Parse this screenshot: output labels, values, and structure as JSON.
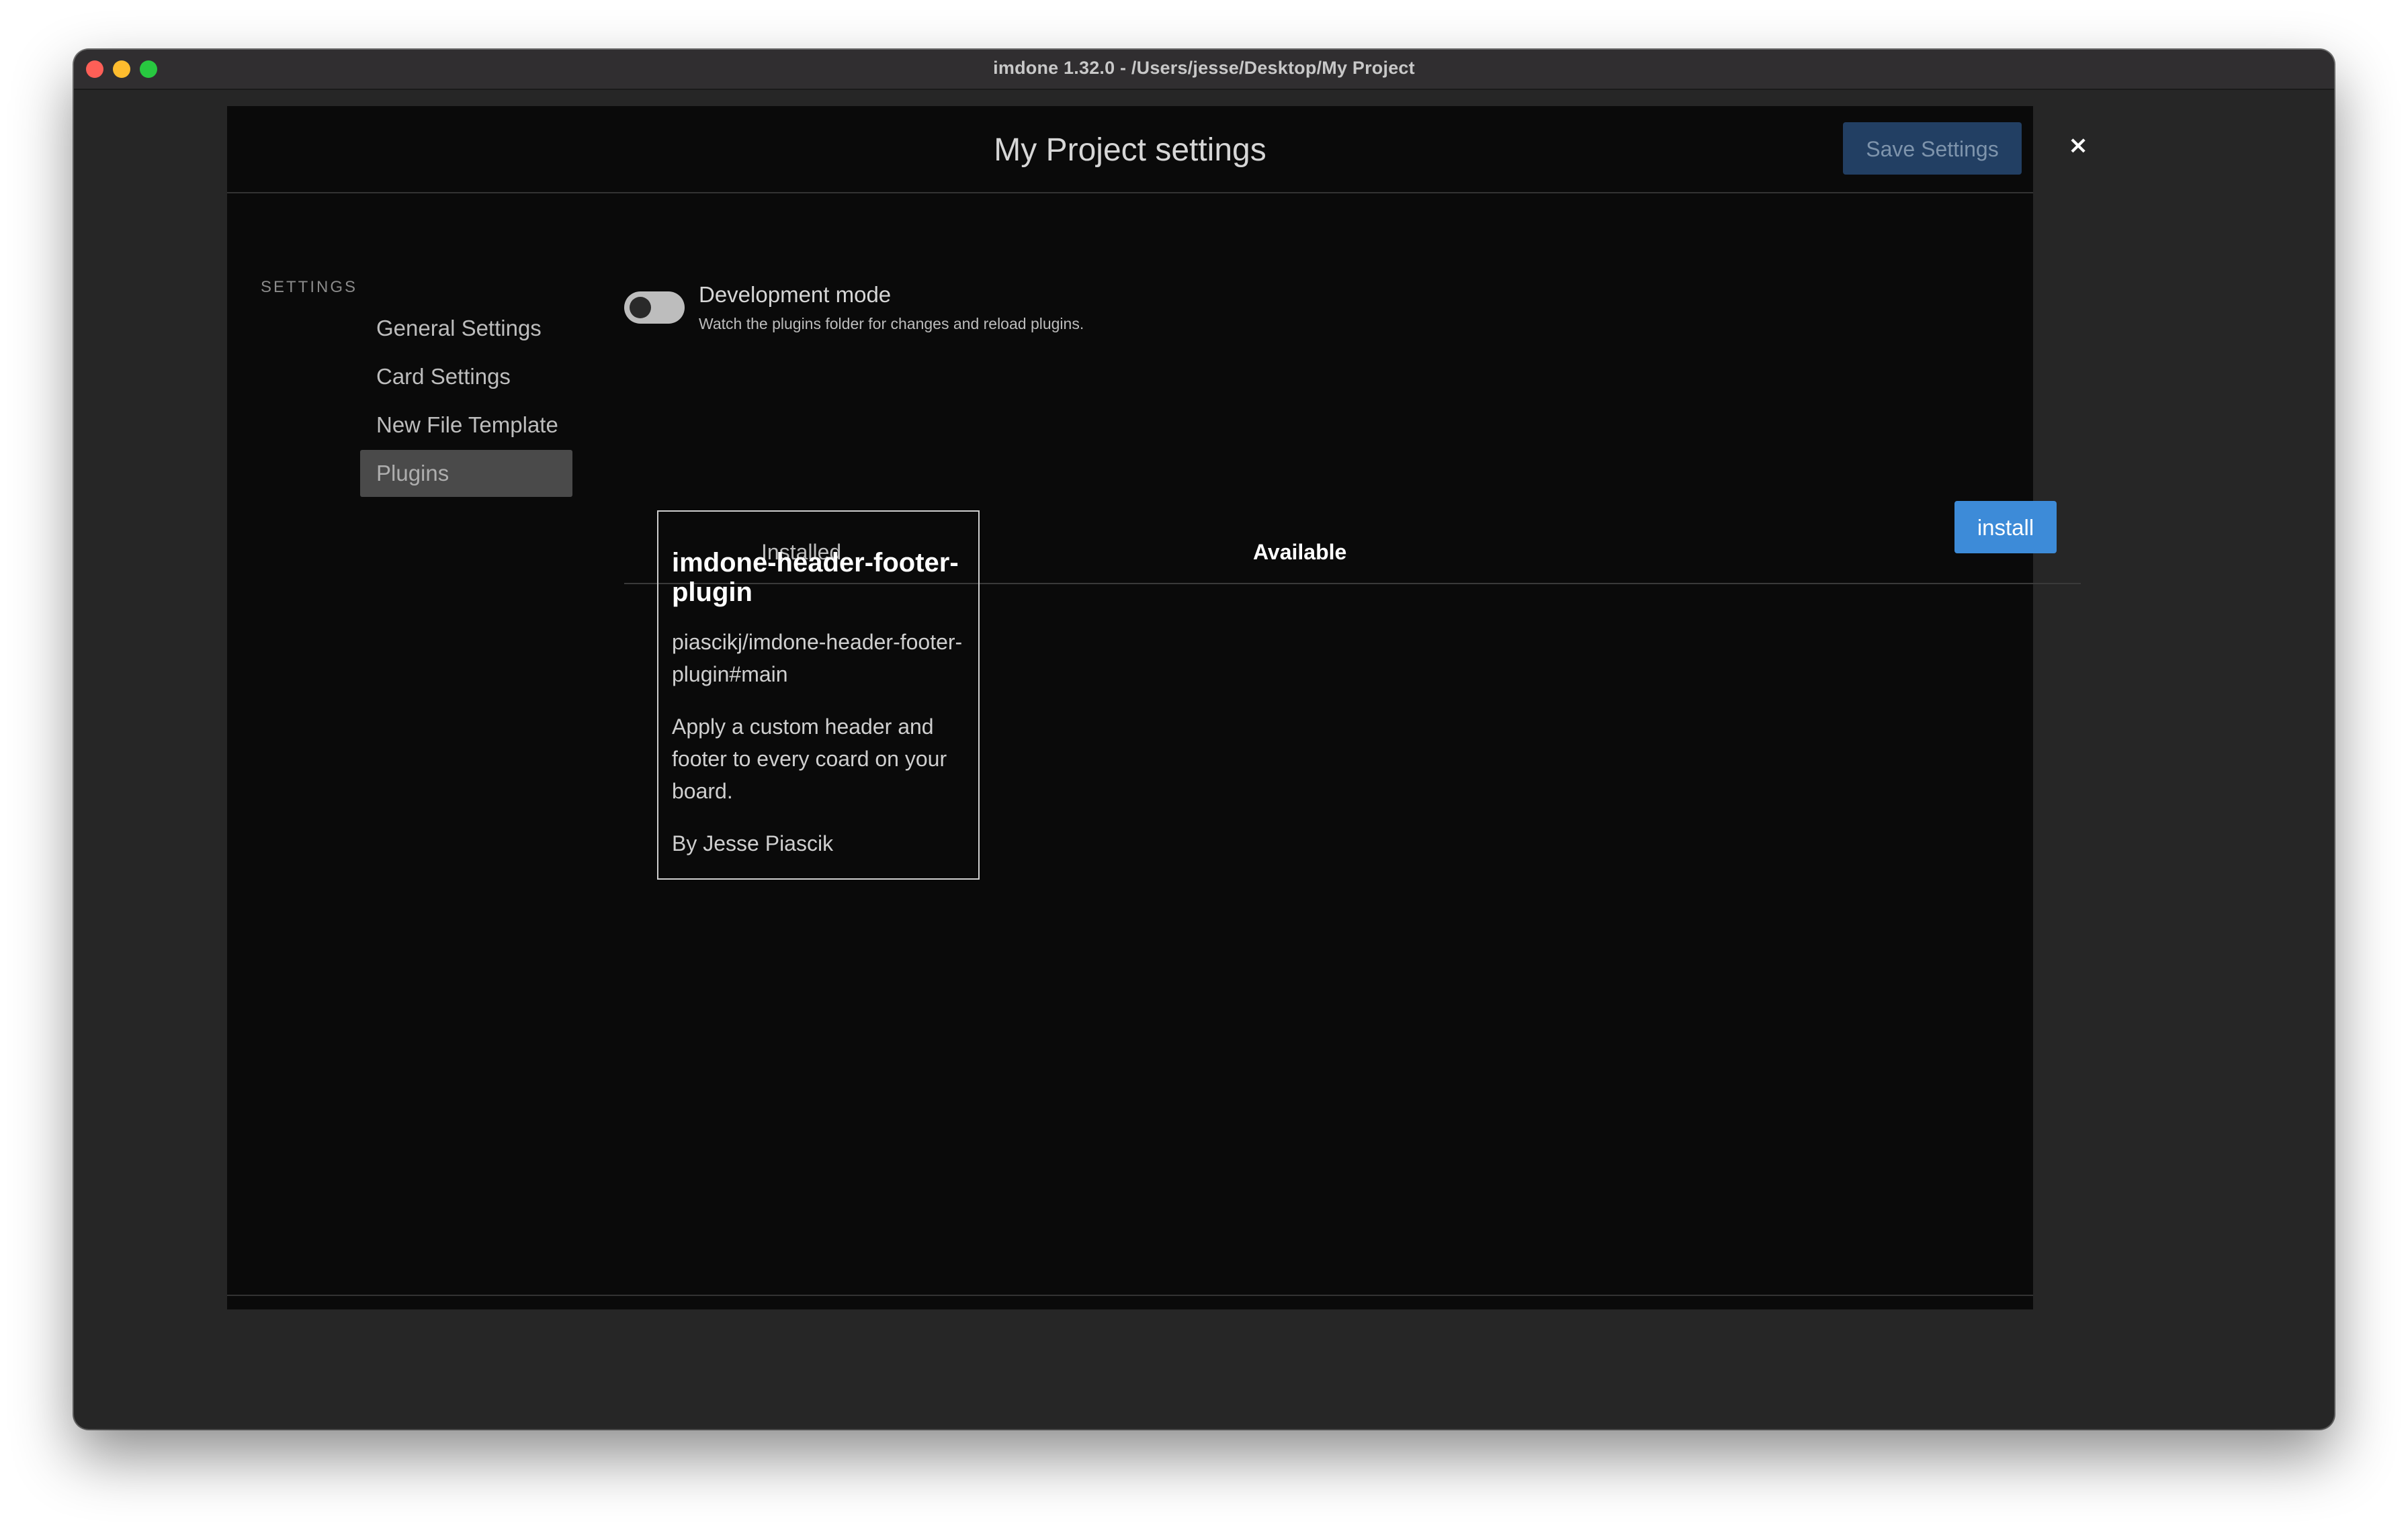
{
  "window": {
    "title": "imdone 1.32.0 - /Users/jesse/Desktop/My Project"
  },
  "modal": {
    "title": "My Project settings",
    "save_label": "Save Settings",
    "close_label": "×"
  },
  "sidebar": {
    "heading": "SETTINGS",
    "items": [
      {
        "label": "General Settings",
        "active": false
      },
      {
        "label": "Card Settings",
        "active": false
      },
      {
        "label": "New File Template",
        "active": false
      },
      {
        "label": "Plugins",
        "active": true
      }
    ]
  },
  "dev_mode": {
    "label": "Development mode",
    "description": "Watch the plugins folder for changes and reload plugins.",
    "enabled": false
  },
  "tabs": [
    {
      "label": "Installed",
      "selected": false
    },
    {
      "label": "Available",
      "selected": true
    }
  ],
  "plugin": {
    "name": "imdone-header-footer-plugin",
    "repo": "piascikj/imdone-header-footer-plugin#main",
    "description": "Apply a custom header and footer to every coard on your board.",
    "author": "By Jesse Piascik",
    "install_label": "install"
  },
  "colors": {
    "accent": "#3d8bd8",
    "save_button_bg": "#223f63",
    "modal_bg": "#0a0a0a",
    "window_bg": "#262626"
  }
}
